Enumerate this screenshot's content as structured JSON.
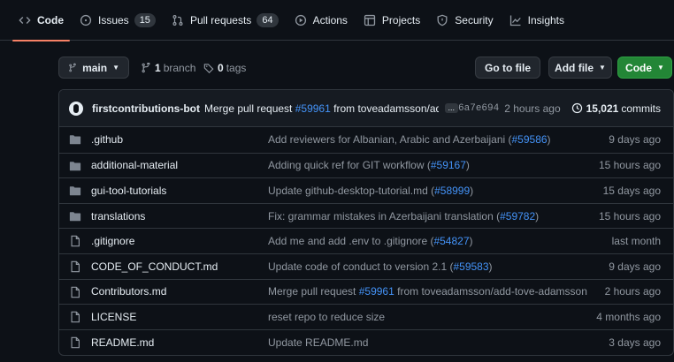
{
  "tabs": [
    {
      "label": "Code",
      "icon": "code-icon",
      "counter": null,
      "active": true
    },
    {
      "label": "Issues",
      "icon": "issues-icon",
      "counter": "15",
      "active": false
    },
    {
      "label": "Pull requests",
      "icon": "pull-request-icon",
      "counter": "64",
      "active": false
    },
    {
      "label": "Actions",
      "icon": "actions-icon",
      "counter": null,
      "active": false
    },
    {
      "label": "Projects",
      "icon": "projects-icon",
      "counter": null,
      "active": false
    },
    {
      "label": "Security",
      "icon": "shield-icon",
      "counter": null,
      "active": false
    },
    {
      "label": "Insights",
      "icon": "graph-icon",
      "counter": null,
      "active": false
    }
  ],
  "toolbar": {
    "branch": "main",
    "branch_count": "1",
    "branch_label": "branch",
    "tag_count": "0",
    "tag_label": "tags",
    "goto_file": "Go to file",
    "add_file": "Add file",
    "code": "Code"
  },
  "commit": {
    "author": "firstcontributions-bot",
    "message_prefix": "Merge pull request",
    "pr": "#59961",
    "message_suffix": "from toveadamsson/add-...",
    "ellipsis": "...",
    "sha": "6a7e694",
    "ago": "2 hours ago",
    "count": "15,021",
    "count_label": "commits"
  },
  "files": [
    {
      "type": "dir",
      "name": ".github",
      "msg": "Add reviewers for Albanian, Arabic and Azerbaijani (",
      "link": "#59586",
      "msg_end": ")",
      "age": "9 days ago"
    },
    {
      "type": "dir",
      "name": "additional-material",
      "msg": "Adding quick ref for GIT workflow (",
      "link": "#59167",
      "msg_end": ")",
      "age": "15 hours ago"
    },
    {
      "type": "dir",
      "name": "gui-tool-tutorials",
      "msg": "Update github-desktop-tutorial.md (",
      "link": "#58999",
      "msg_end": ")",
      "age": "15 days ago"
    },
    {
      "type": "dir",
      "name": "translations",
      "msg": "Fix: grammar mistakes in Azerbaijani translation (",
      "link": "#59782",
      "msg_end": ")",
      "age": "15 hours ago"
    },
    {
      "type": "file",
      "name": ".gitignore",
      "msg": "Add me and add .env to .gitignore (",
      "link": "#54827",
      "msg_end": ")",
      "age": "last month"
    },
    {
      "type": "file",
      "name": "CODE_OF_CONDUCT.md",
      "msg": "Update code of conduct to version 2.1 (",
      "link": "#59583",
      "msg_end": ")",
      "age": "9 days ago"
    },
    {
      "type": "file",
      "name": "Contributors.md",
      "msg": "Merge pull request ",
      "link": "#59961",
      "msg_end": " from toveadamsson/add-tove-adamsson",
      "age": "2 hours ago"
    },
    {
      "type": "file",
      "name": "LICENSE",
      "msg": "reset repo to reduce size",
      "link": "",
      "msg_end": "",
      "age": "4 months ago"
    },
    {
      "type": "file",
      "name": "README.md",
      "msg": "Update README.md",
      "link": "",
      "msg_end": "",
      "age": "3 days ago"
    }
  ],
  "colors": {
    "background": "#0d1117",
    "accent_underline": "#f78166",
    "link": "#4493f8",
    "green_button": "#238636",
    "folder_icon": "#7d8590"
  }
}
